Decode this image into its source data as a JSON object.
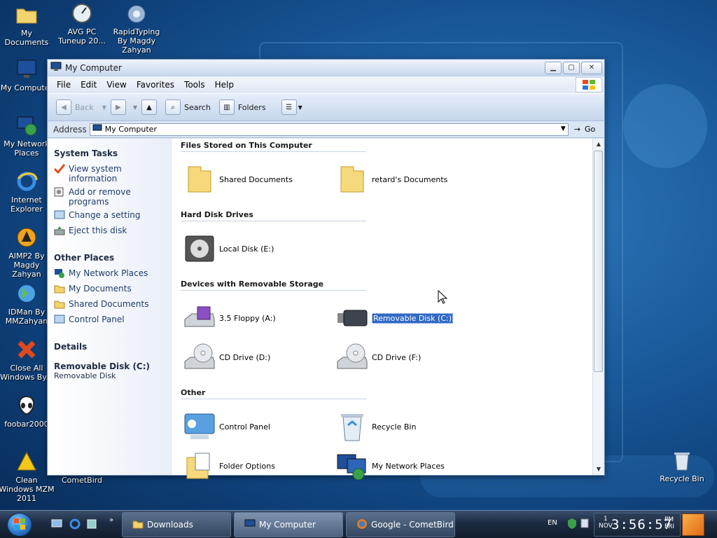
{
  "desktop": {
    "icons": [
      {
        "label": "My Documents"
      },
      {
        "label": "AVG PC Tuneup 20..."
      },
      {
        "label": "RapidTyping By Magdy Zahyan"
      },
      {
        "label": "My Computer"
      },
      {
        "label": "My Network Places"
      },
      {
        "label": "Internet Explorer"
      },
      {
        "label": "AIMP2 By Magdy Zahyan"
      },
      {
        "label": "IDMan By MMZahyan"
      },
      {
        "label": "Close All Windows By..."
      },
      {
        "label": "foobar2000"
      },
      {
        "label": "Clean Windows MZM 2011"
      },
      {
        "label": "CometBird"
      },
      {
        "label": "Recycle Bin"
      }
    ]
  },
  "window": {
    "title": "My Computer",
    "menu": [
      "File",
      "Edit",
      "View",
      "Favorites",
      "Tools",
      "Help"
    ],
    "toolbar": {
      "back": "Back",
      "search": "Search",
      "folders": "Folders"
    },
    "address": {
      "label": "Address",
      "value": "My Computer",
      "go": "Go"
    }
  },
  "sidebar": {
    "system_tasks": {
      "title": "System Tasks",
      "items": [
        "View system information",
        "Add or remove programs",
        "Change a setting",
        "Eject this disk"
      ]
    },
    "other_places": {
      "title": "Other Places",
      "items": [
        "My Network Places",
        "My Documents",
        "Shared Documents",
        "Control Panel"
      ]
    },
    "details": {
      "title": "Details",
      "name": "Removable Disk (C:)",
      "type": "Removable Disk"
    }
  },
  "content": {
    "sections": [
      {
        "title": "Files Stored on This Computer",
        "items": [
          "Shared Documents",
          "retard's Documents"
        ]
      },
      {
        "title": "Hard Disk Drives",
        "items": [
          "Local Disk (E:)"
        ]
      },
      {
        "title": "Devices with Removable Storage",
        "items": [
          "3.5 Floppy (A:)",
          "Removable Disk (C:)",
          "CD Drive (D:)",
          "CD Drive (F:)"
        ]
      },
      {
        "title": "Other",
        "items": [
          "Control Panel",
          "Recycle Bin",
          "Folder Options",
          "My Network Places"
        ]
      }
    ]
  },
  "taskbar": {
    "tasks": [
      "Downloads",
      "My Computer",
      "Google - CometBird"
    ],
    "tray": {
      "lang": "EN",
      "date_day": "1",
      "date_month": "NOV",
      "time": "3:56:57",
      "ampm": "PM",
      "weekday": "FRI"
    }
  },
  "colors": {
    "selection": "#3169c6",
    "link": "#1f3c6b"
  }
}
